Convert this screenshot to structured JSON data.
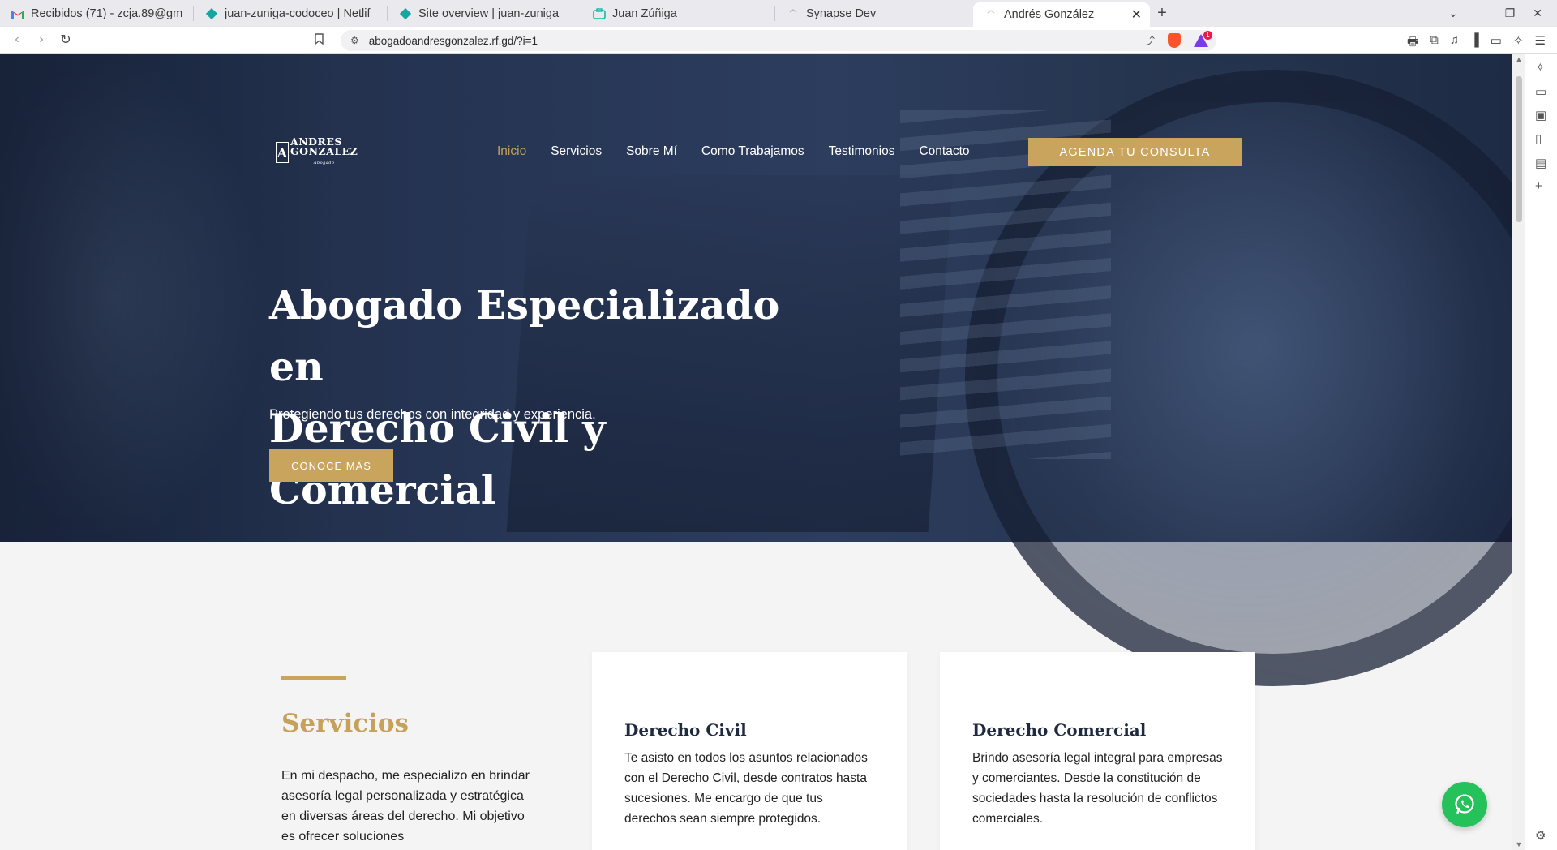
{
  "browser": {
    "tabs": [
      {
        "title": "Recibidos (71) - zcja.89@gm",
        "icon": "gmail-icon"
      },
      {
        "title": "juan-zuniga-codoceo | Netlif",
        "icon": "netlify-icon"
      },
      {
        "title": "Site overview | juan-zuniga",
        "icon": "netlify-icon"
      },
      {
        "title": "Juan Zúñiga",
        "icon": "briefcase-icon"
      },
      {
        "title": "Synapse Dev",
        "icon": "page-icon"
      },
      {
        "title": "Andrés González",
        "icon": "page-icon",
        "active": true
      }
    ],
    "url": "abogadoandresgonzalez.rf.gd/?i=1",
    "brave_badge": "1"
  },
  "site": {
    "logo": {
      "letter": "A",
      "line1": "ANDRES",
      "line2": "GONZALEZ",
      "tagline": "Abogado"
    },
    "nav": [
      "Inicio",
      "Servicios",
      "Sobre Mí",
      "Como Trabajamos",
      "Testimonios",
      "Contacto"
    ],
    "nav_active": "Inicio",
    "cta_top": "AGENDA TU CONSULTA",
    "hero": {
      "title_line1": "Abogado Especializado en",
      "title_line2": "Derecho Civil y Comercial",
      "subtitle": "Protegiendo tus derechos con integridad y experiencia.",
      "cta": "CONOCE MÁS"
    },
    "services": {
      "heading": "Servicios",
      "intro": "En mi despacho, me especializo en brindar asesoría legal personalizada y estratégica en diversas áreas del derecho. Mi objetivo es ofrecer soluciones",
      "cards": [
        {
          "title": "Derecho Civil",
          "text": "Te asisto en todos los asuntos relacionados con el Derecho Civil, desde contratos hasta sucesiones. Me encargo de que tus derechos sean siempre protegidos."
        },
        {
          "title": "Derecho Comercial",
          "text": "Brindo asesoría legal integral para empresas y comerciantes. Desde la constitución de sociedades hasta la resolución de conflictos comerciales."
        }
      ]
    }
  },
  "colors": {
    "accent_gold": "#c9a45d",
    "hero_navy": "#26354f",
    "whatsapp_green": "#25c15a"
  }
}
